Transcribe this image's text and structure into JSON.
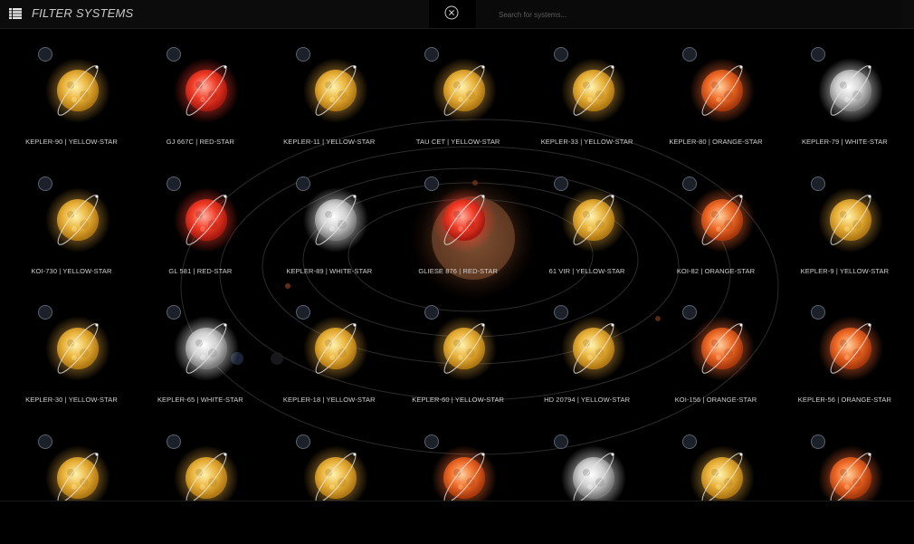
{
  "header": {
    "title": "FILTER SYSTEMS",
    "search_placeholder": "Search for systems..."
  },
  "systems": [
    {
      "label": "KEPLER-90 | YELLOW-STAR",
      "type": "yellow"
    },
    {
      "label": "GJ 667C | RED-STAR",
      "type": "red"
    },
    {
      "label": "KEPLER-11 | YELLOW-STAR",
      "type": "yellow"
    },
    {
      "label": "TAU CET | YELLOW-STAR",
      "type": "yellow"
    },
    {
      "label": "KEPLER-33 | YELLOW-STAR",
      "type": "yellow"
    },
    {
      "label": "KEPLER-80 | ORANGE-STAR",
      "type": "orange"
    },
    {
      "label": "KEPLER-79 | WHITE-STAR",
      "type": "white"
    },
    {
      "label": "KOI-730 | YELLOW-STAR",
      "type": "yellow"
    },
    {
      "label": "GL 581 | RED-STAR",
      "type": "red"
    },
    {
      "label": "KEPLER-89 | WHITE-STAR",
      "type": "white"
    },
    {
      "label": "GLIESE 876 | RED-STAR",
      "type": "red"
    },
    {
      "label": "61 VIR | YELLOW-STAR",
      "type": "yellow"
    },
    {
      "label": "KOI-82 | ORANGE-STAR",
      "type": "orange"
    },
    {
      "label": "KEPLER-9 | YELLOW-STAR",
      "type": "yellow"
    },
    {
      "label": "KEPLER-30 | YELLOW-STAR",
      "type": "yellow"
    },
    {
      "label": "KEPLER-65 | WHITE-STAR",
      "type": "white"
    },
    {
      "label": "KEPLER-18 | YELLOW-STAR",
      "type": "yellow"
    },
    {
      "label": "KEPLER-60 | YELLOW-STAR",
      "type": "yellow"
    },
    {
      "label": "HD 20794 | YELLOW-STAR",
      "type": "yellow"
    },
    {
      "label": "KOI-156 | ORANGE-STAR",
      "type": "orange"
    },
    {
      "label": "KEPLER-56 | ORANGE-STAR",
      "type": "orange"
    },
    {
      "label": "",
      "type": "yellow"
    },
    {
      "label": "",
      "type": "yellow"
    },
    {
      "label": "",
      "type": "yellow"
    },
    {
      "label": "",
      "type": "orange"
    },
    {
      "label": "",
      "type": "white"
    },
    {
      "label": "",
      "type": "yellow"
    },
    {
      "label": "",
      "type": "orange"
    }
  ],
  "star_colors": {
    "yellow": [
      "#fff3b0",
      "#e9b23a",
      "#b07812",
      "#e2a43a"
    ],
    "red": [
      "#ffb0a0",
      "#f03a24",
      "#a81a10",
      "#ff3a2a"
    ],
    "orange": [
      "#ffd0a0",
      "#ef6a26",
      "#a8380c",
      "#ff6a30"
    ],
    "white": [
      "#ffffff",
      "#cfcfcf",
      "#7a7a7a",
      "#ffffff"
    ]
  }
}
